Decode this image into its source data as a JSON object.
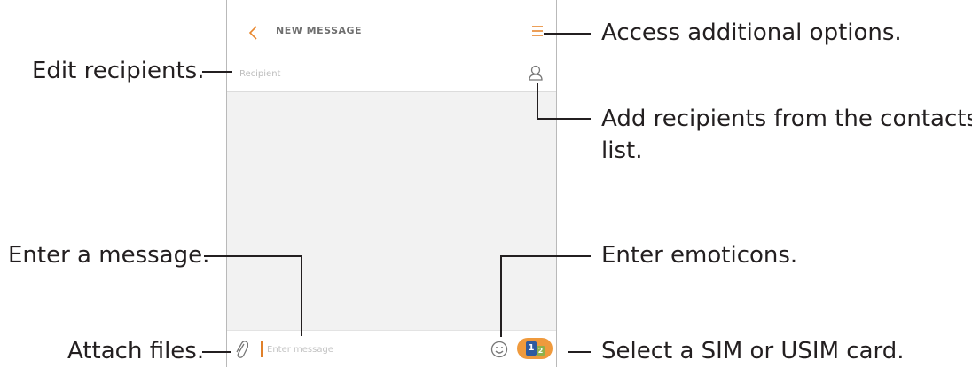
{
  "app": {
    "title": "NEW MESSAGE",
    "recipient_placeholder": "Recipient",
    "message_placeholder": "Enter message",
    "sim_labels": [
      "1",
      "2"
    ],
    "icons": {
      "back": "chevron-left-icon",
      "menu": "menu-icon",
      "contacts": "contacts-icon",
      "attach": "paperclip-icon",
      "emoticon": "emoticon-icon",
      "sim": "sim-card-icon"
    },
    "colors": {
      "accent": "#ef9a3d",
      "sim1": "#2e5a9f",
      "sim2": "#8fb04a",
      "background": "#f2f2f2"
    }
  },
  "callouts": {
    "access_options": "Access additional options.",
    "edit_recipients": "Edit recipients.",
    "add_recipients_line1": "Add recipients from the contacts",
    "add_recipients_line2": "list.",
    "enter_message": "Enter a message.",
    "enter_emoticons": "Enter emoticons.",
    "attach_files": "Attach files.",
    "select_sim": "Select a SIM or USIM card."
  }
}
